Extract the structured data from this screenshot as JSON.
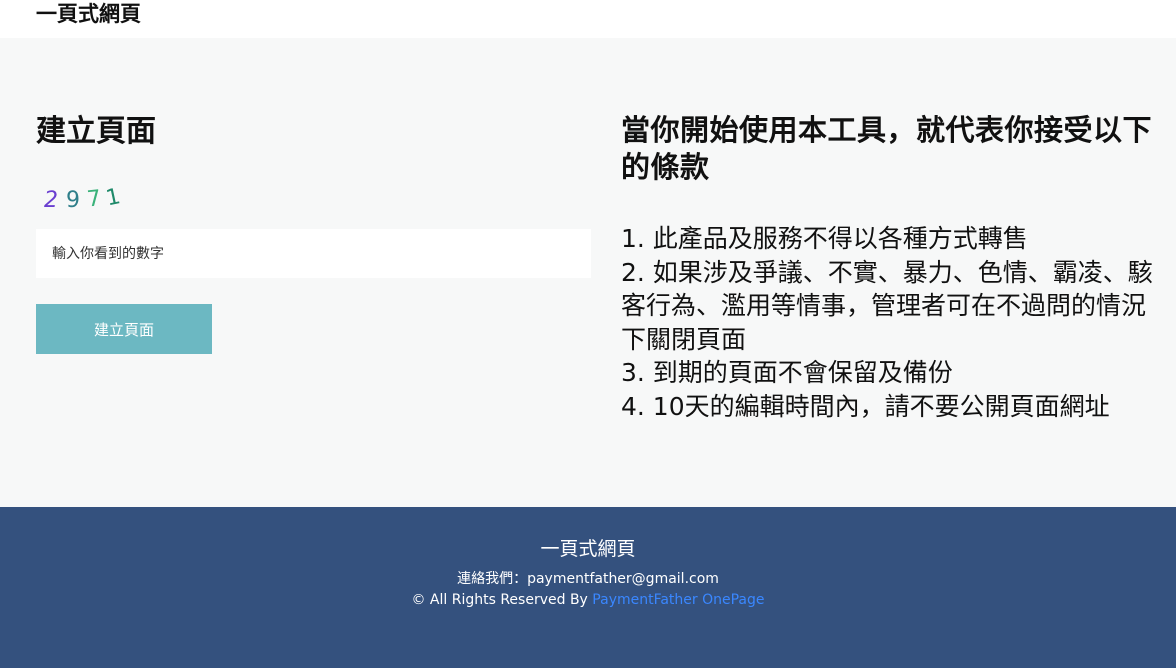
{
  "header": {
    "brand": "一頁式網頁"
  },
  "form": {
    "title": "建立頁面",
    "captcha_code": "2971",
    "input_placeholder": "輸入你看到的數字",
    "input_value": "",
    "submit_label": "建立頁面"
  },
  "terms": {
    "title": "當你開始使用本工具，就代表你接受以下的條款",
    "items": [
      "1. 此產品及服務不得以各種方式轉售",
      "2. 如果涉及爭議、不實、暴力、色情、霸凌、駭客行為、濫用等情事，管理者可在不過問的情況下關閉頁面",
      "3. 到期的頁面不會保留及備份",
      "4. 10天的編輯時間內，請不要公開頁面網址"
    ]
  },
  "footer": {
    "title": "一頁式網頁",
    "contact": "連絡我們：paymentfather@gmail.com",
    "copyright_prefix": "© All Rights Reserved By",
    "link_text": "PaymentFather OnePage"
  },
  "colors": {
    "main_bg": "#f7f8f8",
    "button": "#6cb8c2",
    "footer_bg": "#34517e",
    "link": "#3a87ff"
  }
}
